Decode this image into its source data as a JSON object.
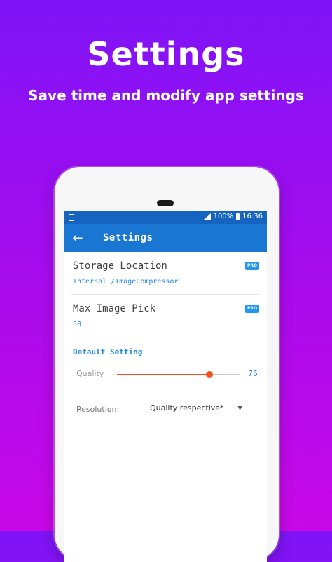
{
  "promo": {
    "title": "Settings",
    "subtitle": "Save time and modify app settings"
  },
  "statusbar": {
    "battery": "100%",
    "time": "16:36"
  },
  "appbar": {
    "title": "Settings",
    "back_icon": "arrow-left-icon"
  },
  "prefs": [
    {
      "title": "Storage Location",
      "summary": "Internal /ImageCompressor",
      "badge": "PRO"
    },
    {
      "title": "Max Image Pick",
      "summary": "50",
      "badge": "PRO"
    }
  ],
  "default_setting": {
    "header": "Default Setting",
    "quality": {
      "label": "Quality",
      "value": 75,
      "display": "75",
      "min": 0,
      "max": 100
    },
    "resolution": {
      "label": "Resolution:",
      "selected": "Quality respective*"
    }
  },
  "colors": {
    "background_top": "#7f14f6",
    "background_bottom": "#c808e6",
    "appbar": "#1976d2",
    "statusbar": "#1565c0",
    "accent": "#1e88e5",
    "slider": "#f4511e"
  }
}
